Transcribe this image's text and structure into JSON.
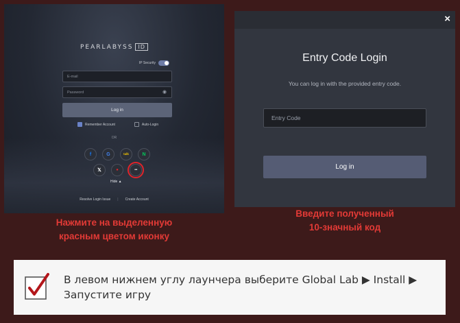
{
  "login_screen": {
    "logo_text": "PEARLABYSS",
    "logo_badge": "ID",
    "ip_security_label": "IP Security",
    "email_placeholder": "E-mail",
    "password_placeholder": "Password",
    "login_label": "Log in",
    "remember_label": "Remember Account",
    "autologin_label": "Auto-Login",
    "or_label": "OR",
    "hide_label": "Hide ▲",
    "resolve_label": "Resolve Login Issue",
    "create_label": "Create Account",
    "social": [
      {
        "name": "facebook",
        "glyph": "f",
        "color": "#1877f2"
      },
      {
        "name": "google",
        "glyph": "G",
        "color": "#4285f4"
      },
      {
        "name": "naver-talk",
        "glyph": "talk",
        "color": "#f5c400"
      },
      {
        "name": "naver",
        "glyph": "N",
        "color": "#03c75a"
      },
      {
        "name": "x",
        "glyph": "𝕏",
        "color": "#ffffff"
      },
      {
        "name": "pearl",
        "glyph": "●",
        "color": "#e0242a"
      },
      {
        "name": "entry-code",
        "glyph": "•••",
        "color": "#d7d9dd"
      }
    ]
  },
  "left_caption": {
    "line1": "Нажмите на выделенную",
    "line2": "красным цветом иконку"
  },
  "entry_dialog": {
    "close_label": "×",
    "title": "Entry Code Login",
    "subtitle": "You can log in with the provided entry code.",
    "input_placeholder": "Entry Code",
    "login_label": "Log in"
  },
  "right_caption": {
    "line1": "Введите полученный",
    "line2": "10-значный код"
  },
  "instruction": {
    "text": "В левом нижнем углу лаунчера выберите Global Lab ▶ Install ▶ Запустите игру"
  },
  "colors": {
    "background": "#3d1a1a",
    "caption_red": "#e33a36",
    "highlight_ring": "#e0242a",
    "login_button": "#5c6478"
  }
}
